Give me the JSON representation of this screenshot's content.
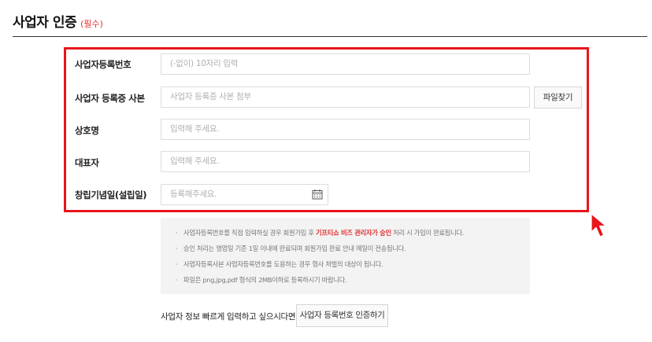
{
  "header": {
    "title": "사업자 인증",
    "required": "(필수)"
  },
  "form": {
    "fields": [
      {
        "label": "사업자등록번호",
        "placeholder": "(-없이) 10자리 입력"
      },
      {
        "label": "사업자 등록증 사본",
        "placeholder": "사업자 등록증 사본 첨부"
      },
      {
        "label": "상호명",
        "placeholder": "입력해 주세요."
      },
      {
        "label": "대표자",
        "placeholder": "입력해 주세요."
      },
      {
        "label": "창립기념일(설립일)",
        "placeholder": "등록해주세요."
      }
    ],
    "file_button": "파일찾기",
    "highlight_color": "#e8151b"
  },
  "notice": {
    "item1": {
      "before": "사업자등록번호를 직접 입력하실 경우 회원가입 후 ",
      "highlight": "기프티쇼 비즈 관리자가 승인",
      "after": " 처리 시 가입이 완료됩니다."
    },
    "item2": "승인 처리는 영업일 기준 1일 이내에 완료되며 회원가입 완료 안내 메일이 전송됩니다.",
    "item3": "사업자등록사본 사업자등록번호를 도용하는 경우 형사 처벌의 대상이 됩니다.",
    "item4": "파일은 png,jpg,pdf 형식의 2MB이하로 등록하시기 바랍니다.",
    "highlight_color": "#e03131"
  },
  "quick": {
    "text": "사업자 정보 빠르게 입력하고 싶으시다면?",
    "button": "사업자 등록번호 인증하기"
  },
  "icons": {
    "calendar": "calendar-icon",
    "cursor": "cursor-arrow-icon"
  }
}
